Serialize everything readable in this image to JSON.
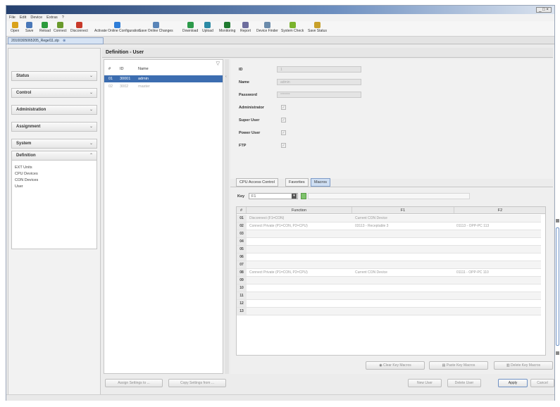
{
  "window": {
    "controls": "_ □ ×"
  },
  "menu": [
    "File",
    "Edit",
    "Device",
    "Extras",
    "?"
  ],
  "toolbar": [
    {
      "label": "Open",
      "icon": "folder-icon",
      "color": "#d9a21b"
    },
    {
      "label": "Save",
      "icon": "save-icon",
      "color": "#4a78b8"
    },
    {
      "label": "Reload",
      "icon": "reload-icon",
      "color": "#2c9a3c"
    },
    {
      "label": "Connect",
      "icon": "connect-icon",
      "color": "#6a9a2c"
    },
    {
      "label": "Disconnect",
      "icon": "disconnect-icon",
      "color": "#c83a2a"
    },
    {
      "label": "Activate Online Configuration",
      "icon": "activate-icon",
      "color": "#2f7ed8"
    },
    {
      "label": "Save Online Changes",
      "icon": "save-online-icon",
      "color": "#5a85b8"
    },
    {
      "label": "Download",
      "icon": "download-icon",
      "color": "#2c9a4a"
    },
    {
      "label": "Upload",
      "icon": "upload-icon",
      "color": "#2c8aa5"
    },
    {
      "label": "Monitoring",
      "icon": "monitoring-icon",
      "color": "#1f7a2f"
    },
    {
      "label": "Report",
      "icon": "report-icon",
      "color": "#6d6d9d"
    },
    {
      "label": "Device Finder",
      "icon": "device-finder-icon",
      "color": "#6b8bab"
    },
    {
      "label": "System Check",
      "icon": "system-check-icon",
      "color": "#7ab32c"
    },
    {
      "label": "Save Status",
      "icon": "save-status-icon",
      "color": "#c8a02a"
    }
  ],
  "file_tab": {
    "label": "20100305065205_Regel11.zip"
  },
  "nav": {
    "items": [
      "Status",
      "Control",
      "Administration",
      "Assignment",
      "System"
    ],
    "definition": {
      "label": "Definition",
      "subitems": [
        "EXT Units",
        "CPU Devices",
        "CON Devices",
        "User"
      ]
    }
  },
  "panel": {
    "title": "Definition - User"
  },
  "users": {
    "headers": [
      "#",
      "ID",
      "Name"
    ],
    "rows": [
      {
        "num": "01",
        "id": "30001",
        "name": "admin",
        "selected": true
      },
      {
        "num": "02",
        "id": "3002",
        "name": "master",
        "selected": false
      }
    ]
  },
  "detail": {
    "fields": [
      {
        "label": "ID",
        "value": "1"
      },
      {
        "label": "Name",
        "value": "admin"
      },
      {
        "label": "Password",
        "value": "*******"
      }
    ],
    "checks": [
      "Administrator",
      "Super User",
      "Power User",
      "FTP"
    ],
    "check_mark": "✓"
  },
  "subtabs": [
    "CPU Access Control",
    "Favorites",
    "Macros"
  ],
  "macros": {
    "key_label": "Key",
    "key_value": "F1",
    "columns": [
      "#",
      "Function",
      "F1",
      "F2"
    ],
    "rows": [
      {
        "num": "01",
        "f": "Disconnect (F1=CON)",
        "p1": "Current CON Device",
        "p2": ""
      },
      {
        "num": "02",
        "f": "Connect Private (P1=CON, P2=CPU)",
        "p1": "03113 - Receptable 3",
        "p2": "01113 - OPP-PC 113"
      },
      {
        "num": "03",
        "f": "",
        "p1": "",
        "p2": ""
      },
      {
        "num": "04",
        "f": "",
        "p1": "",
        "p2": ""
      },
      {
        "num": "05",
        "f": "",
        "p1": "",
        "p2": ""
      },
      {
        "num": "06",
        "f": "",
        "p1": "",
        "p2": ""
      },
      {
        "num": "07",
        "f": "",
        "p1": "",
        "p2": ""
      },
      {
        "num": "08",
        "f": "Connect Private (P1=CON, P2=CPU)",
        "p1": "Current CON Device",
        "p2": "01111 - OPP-PC 110"
      },
      {
        "num": "09",
        "f": "",
        "p1": "",
        "p2": ""
      },
      {
        "num": "10",
        "f": "",
        "p1": "",
        "p2": ""
      },
      {
        "num": "11",
        "f": "",
        "p1": "",
        "p2": ""
      },
      {
        "num": "12",
        "f": "",
        "p1": "",
        "p2": ""
      },
      {
        "num": "13",
        "f": "",
        "p1": "",
        "p2": ""
      }
    ]
  },
  "macro_buttons": [
    "Clear Key Macros",
    "Paste Key Macros",
    "Delete Key Macros"
  ],
  "bottom_left_buttons": [
    "Assign Settings to ...",
    "Copy Settings from ..."
  ],
  "bottom_right_buttons": [
    "New User",
    "Delete User",
    "Apply",
    "Cancel"
  ]
}
